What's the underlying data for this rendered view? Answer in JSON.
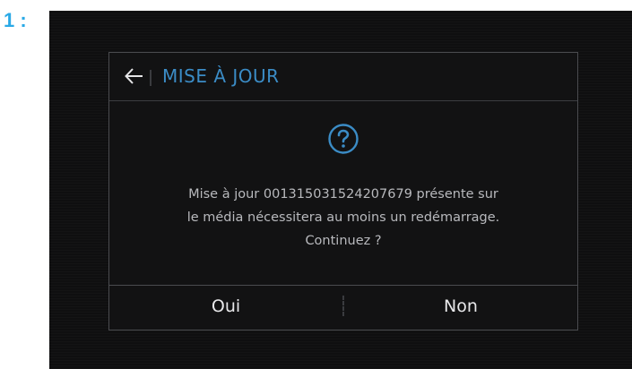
{
  "step_label": "1 :",
  "dialog": {
    "title": "MISE À JOUR",
    "icon": "question-icon",
    "message_lines": [
      "Mise à jour 001315031524207679 présente sur",
      "le média nécessitera au moins un redémarrage.",
      "Continuez ?"
    ],
    "yes_label": "Oui",
    "no_label": "Non"
  },
  "colors": {
    "accent": "#3b8cc6",
    "step_label": "#2aa9e6",
    "text": "#b8b9bd",
    "background": "#0f0f10"
  }
}
